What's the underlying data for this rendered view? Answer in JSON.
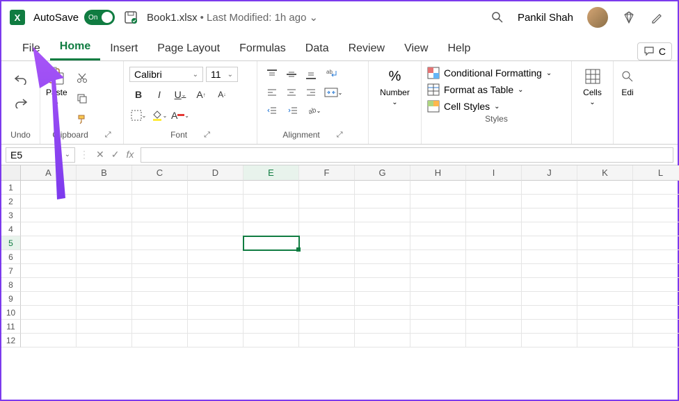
{
  "titlebar": {
    "autosave_label": "AutoSave",
    "toggle_state": "On",
    "doc_name": "Book1.xlsx",
    "modified": "• Last Modified: 1h ago",
    "user_name": "Pankil Shah"
  },
  "tabs": {
    "items": [
      "File",
      "Home",
      "Insert",
      "Page Layout",
      "Formulas",
      "Data",
      "Review",
      "View",
      "Help"
    ],
    "active_index": 1,
    "comments_label": "C"
  },
  "ribbon": {
    "undo_label": "Undo",
    "clipboard_label": "Clipboard",
    "paste_label": "Paste",
    "font_label": "Font",
    "font_name": "Calibri",
    "font_size": "11",
    "alignment_label": "Alignment",
    "number_label": "Number",
    "styles_label": "Styles",
    "cond_fmt": "Conditional Formatting",
    "fmt_table": "Format as Table",
    "cell_styles": "Cell Styles",
    "cells_label": "Cells",
    "edit_label": "Edi"
  },
  "formula_bar": {
    "cell_ref": "E5",
    "fx": "fx"
  },
  "sheet": {
    "columns": [
      "A",
      "B",
      "C",
      "D",
      "E",
      "F",
      "G",
      "H",
      "I",
      "J",
      "K",
      "L"
    ],
    "rows": [
      "1",
      "2",
      "3",
      "4",
      "5",
      "6",
      "7",
      "8",
      "9",
      "10",
      "11",
      "12"
    ],
    "selected_col": 4,
    "selected_row": 4
  }
}
